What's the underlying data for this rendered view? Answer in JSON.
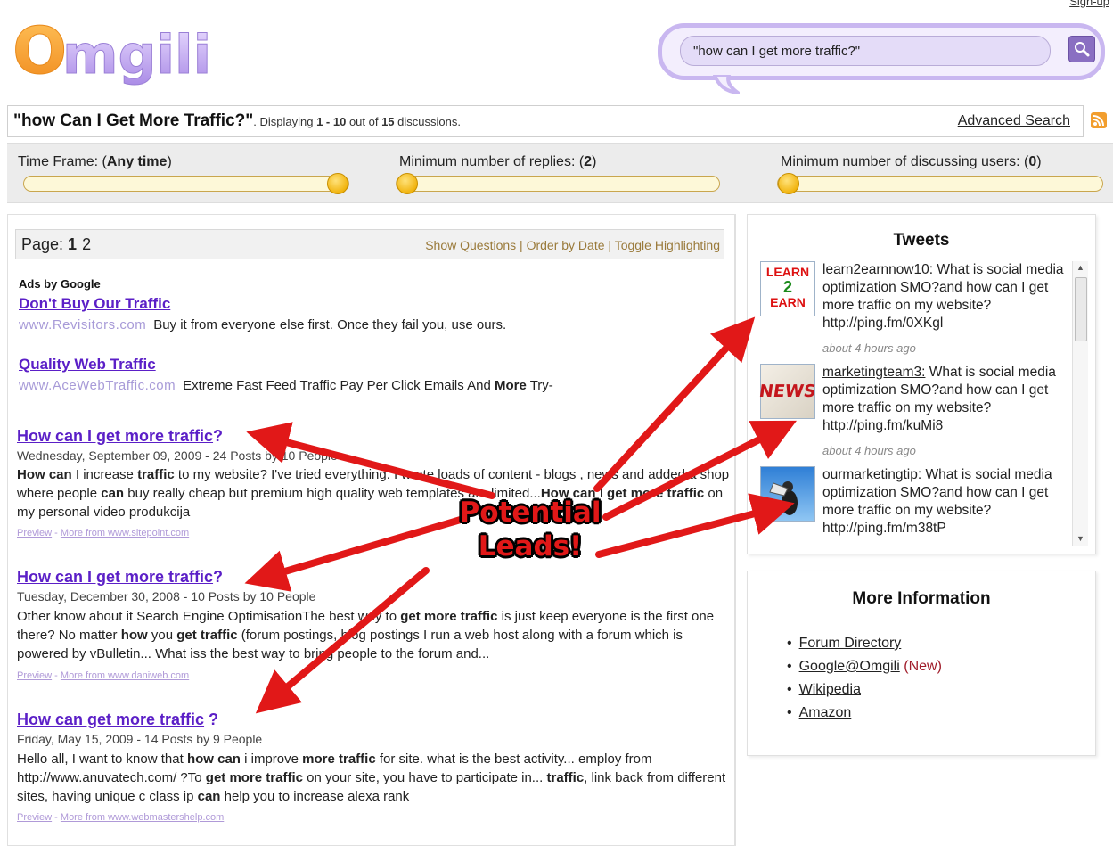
{
  "header": {
    "signup_label": "Sign-up",
    "logo_text": "Omgili",
    "search_value": "\"how can I get more traffic?\""
  },
  "query_bar": {
    "query": "\"how Can I Get More Traffic?\"",
    "displaying_prefix": ". Displaying ",
    "range": "1 - 10",
    "out_of": " out of ",
    "total": "15",
    "suffix": " discussions.",
    "advanced_search": "Advanced Search"
  },
  "filters": {
    "time_frame": {
      "label": "Time Frame: (",
      "value": "Any time",
      "close": ")",
      "level": 1.0
    },
    "min_replies": {
      "label": "Minimum number of replies: (",
      "value": "2",
      "close": ")",
      "level": 0.0
    },
    "min_users": {
      "label": "Minimum number of discussing users: (",
      "value": "0",
      "close": ")",
      "level": 0.0
    }
  },
  "pager": {
    "label": "Page: ",
    "current": "1",
    "other": "2",
    "show_questions": "Show Questions",
    "sep1": "  | ",
    "order_by_date": "Order by Date",
    "sep2": " | ",
    "toggle_highlighting": "Toggle Highlighting"
  },
  "ads": {
    "heading": "Ads by Google",
    "items": [
      {
        "title": "Don't Buy Our Traffic",
        "url": "www.Revisitors.com",
        "text": "Buy it from everyone else first. Once they fail you, use ours."
      },
      {
        "title": "Quality Web Traffic",
        "url": "www.AceWebTraffic.com",
        "text_before": "Extreme Fast Feed Traffic Pay Per Click Emails And ",
        "text_bold": "More",
        "text_after": " Try-"
      }
    ]
  },
  "results": [
    {
      "title": "How can I get more traffic",
      "qmark": "?",
      "meta": "Wednesday, September 09, 2009 - 24 Posts by 10 People",
      "preview": "Preview",
      "more_from": "More from www.sitepoint.com"
    },
    {
      "title": "How can I get more traffic",
      "qmark": "?",
      "meta": "Tuesday, December 30, 2008 - 10 Posts by 10 People",
      "preview": "Preview",
      "more_from": "More from www.daniweb.com"
    },
    {
      "title": "How can get more traffic",
      "qmark": " ?",
      "meta": "Friday, May 15, 2009 - 14 Posts by 9 People",
      "preview": "Preview",
      "more_from": "More from www.webmastershelp.com"
    }
  ],
  "tweets": {
    "heading": "Tweets",
    "items": [
      {
        "user": "learn2earnnow10:",
        "text": " What is social media optimization SMO?and how can I get more traffic on my website? http://ping.fm/0XKgl",
        "time": "about 4 hours ago",
        "avatar_lines": [
          "LEARN",
          "2",
          "EARN"
        ]
      },
      {
        "user": "marketingteam3:",
        "text": " What is social media optimization SMO?and how can I get more traffic on my website? http://ping.fm/kuMi8",
        "time": "about 4 hours ago",
        "avatar_text": "NEWS"
      },
      {
        "user": "ourmarketingtip:",
        "text": " What is social media optimization SMO?and how can I get more traffic on my website? http://ping.fm/m38tP"
      }
    ]
  },
  "more_info": {
    "heading": "More Information",
    "items": [
      {
        "label": "Forum Directory"
      },
      {
        "label": "Google@Omgili",
        "badge": "New"
      },
      {
        "label": "Wikipedia"
      },
      {
        "label": "Amazon"
      }
    ]
  },
  "annotation": {
    "line1": "Potential",
    "line2": "Leads!"
  },
  "colors": {
    "link_purple": "#5b1fc7",
    "arrow_red": "#e11818",
    "slider_knob": "#f1b40f",
    "search_border": "#c9b7f0"
  }
}
